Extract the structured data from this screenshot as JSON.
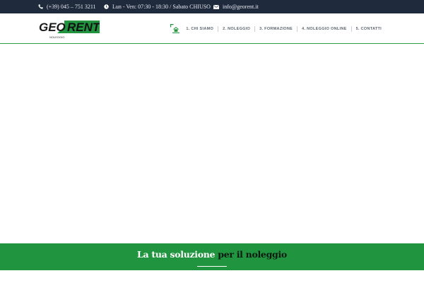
{
  "topbar": {
    "phone": "(+39) 045 – 751 3211",
    "hours": "Lun - Ven: 07:30 - 18:30 / Sabato CHIUSO",
    "email": "info@georent.it",
    "icons": [
      "phone-icon",
      "clock-icon",
      "envelope-icon"
    ]
  },
  "logo": {
    "text_left": "GEO",
    "text_right": "RENT",
    "tagline": "NOLEGGIO"
  },
  "nav": {
    "home_icon": "home-icon",
    "items": [
      {
        "label": "1. CHI SIAMO"
      },
      {
        "label": "2. NOLEGGIO"
      },
      {
        "label": "3. FORMAZIONE"
      },
      {
        "label": "4. NOLEGGIO ONLINE"
      },
      {
        "label": "5. CONTATTI"
      }
    ]
  },
  "banner": {
    "heading_part1": "La tua soluzione",
    "heading_part2": "per il noleggio"
  },
  "colors": {
    "topbar_bg": "#1f2a3d",
    "brand_green": "#21943f",
    "logo_dark": "#1a1a1a",
    "nav_text": "#5e6670"
  }
}
